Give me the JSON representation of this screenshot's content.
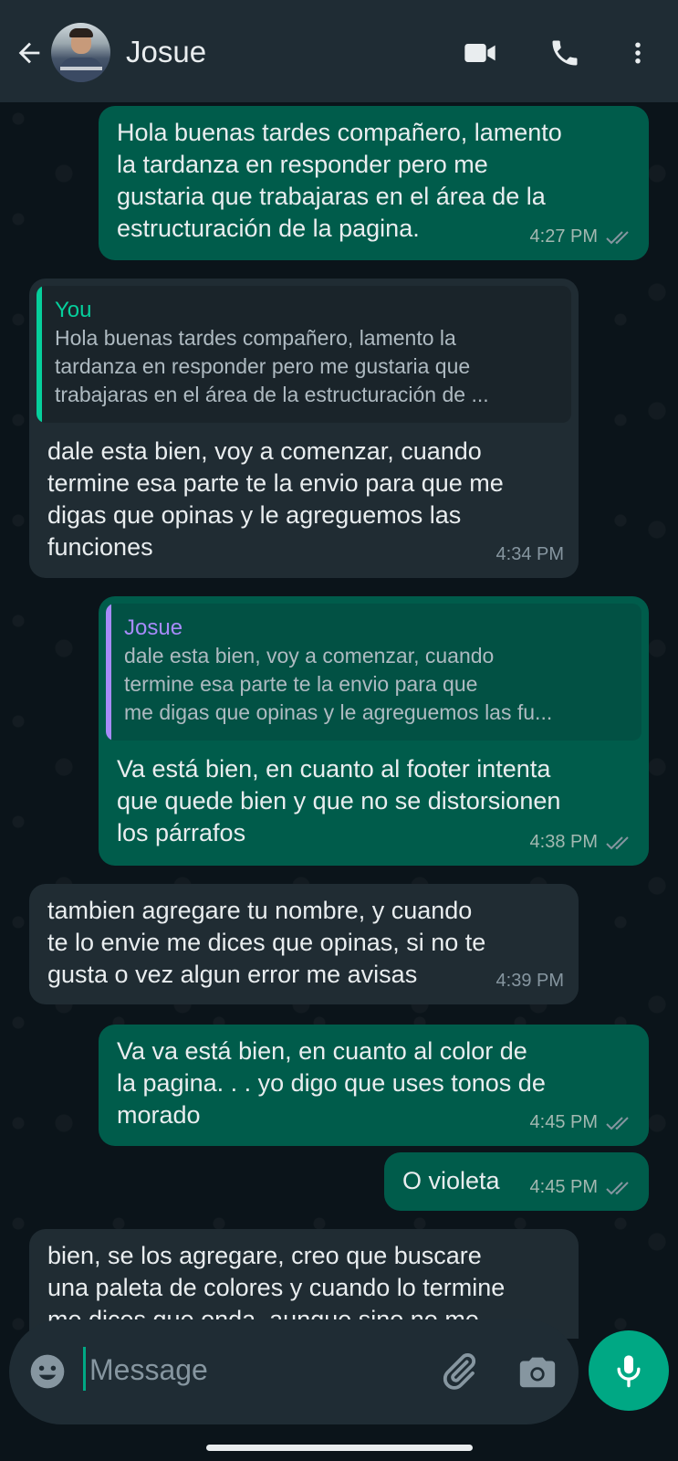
{
  "header": {
    "contact_name": "Josue",
    "icons": [
      "back-arrow-icon",
      "video-call-icon",
      "voice-call-icon",
      "more-vert-icon"
    ]
  },
  "colors": {
    "header_bg": "#1f2c34",
    "chat_bg": "#0b141a",
    "outgoing_bubble": "#005c4b",
    "incoming_bubble": "#202c33",
    "accent": "#00a884",
    "quote_you": "#06cf9c",
    "quote_josue": "#a78bfa",
    "read_ticks": "#8696a0"
  },
  "messages": [
    {
      "dir": "out",
      "text": "Hola buenas tardes compañero, lamento\nla tardanza en responder pero me\ngustaria que trabajaras en el área de la\nestructuración de la pagina.",
      "time": "4:27 PM",
      "status": "read"
    },
    {
      "dir": "in",
      "quote": {
        "author": "You",
        "text": "Hola buenas tardes compañero, lamento la\ntardanza en responder pero me gustaria que\ntrabajaras en el área de la estructuración de ..."
      },
      "text": "dale esta bien, voy a comenzar, cuando\ntermine esa parte te la envio para que me\ndigas que opinas y le agreguemos las\nfunciones",
      "time": "4:34 PM"
    },
    {
      "dir": "out",
      "quote": {
        "author": "Josue",
        "text": "dale esta bien, voy a comenzar, cuando\ntermine esa parte te la envio para que\nme digas que opinas y le agreguemos las fu..."
      },
      "text": "Va está bien, en cuanto al footer intenta\nque quede bien y que no se distorsionen\nlos párrafos",
      "time": "4:38 PM",
      "status": "read"
    },
    {
      "dir": "in",
      "text": "tambien agregare tu nombre, y cuando\nte lo envie me dices que opinas, si no te\ngusta o vez algun error me avisas",
      "time": "4:39 PM"
    },
    {
      "dir": "out",
      "text": "Va va está bien, en cuanto al color de\nla pagina. . . yo digo que uses tonos de\nmorado",
      "time": "4:45 PM",
      "status": "read"
    },
    {
      "dir": "out",
      "text": "O violeta",
      "time": "4:45 PM",
      "status": "read"
    },
    {
      "dir": "in",
      "text": "bien, se los agregare, creo que buscare\nuna paleta de colores y cuando lo termine\nme dices que onda, aunque sino no me",
      "time": ""
    }
  ],
  "composer": {
    "placeholder": "Message",
    "value": "",
    "icons": [
      "emoji-icon",
      "attach-icon",
      "camera-icon",
      "mic-icon"
    ]
  }
}
